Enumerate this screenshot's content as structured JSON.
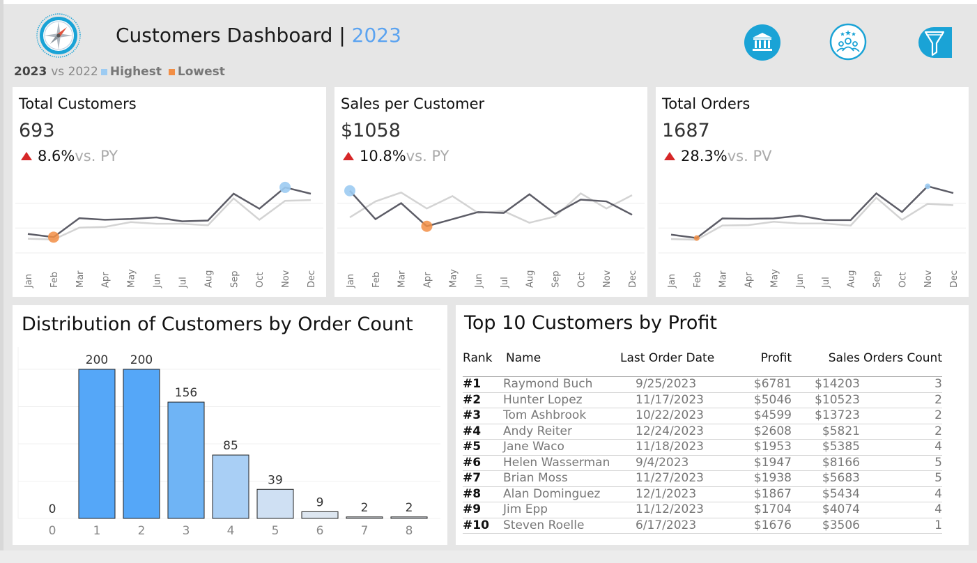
{
  "header": {
    "title_main": "Customers Dashboard",
    "title_sep": "|",
    "title_year": "2023",
    "legend": {
      "current": "2023",
      "vs": "vs 2022",
      "highest": "Highest",
      "lowest": "Lowest"
    },
    "icons": [
      "compass-logo-icon",
      "bank-icon",
      "customers-icon",
      "filter-icon"
    ],
    "colors": {
      "accent": "#5ba3f0",
      "highest": "#9ccbf2",
      "lowest": "#f28e45",
      "nav_icon": "#1aa3d6"
    }
  },
  "months": [
    "Jan",
    "Feb",
    "Mar",
    "Apr",
    "May",
    "Jun",
    "Jul",
    "Aug",
    "Sep",
    "Oct",
    "Nov",
    "Dec"
  ],
  "kpis": [
    {
      "title": "Total Customers",
      "value": "693",
      "change": "8.6%",
      "vs_label": "vs. PY",
      "chart_data": {
        "type": "line",
        "ylim": [
          20,
          110
        ],
        "grid": true,
        "series": [
          {
            "values": [
              44,
              40,
              64,
              62,
              63,
              65,
              60,
              61,
              95,
              76,
              103,
              95
            ],
            "highlight": {
              "highest": 10,
              "lowest": 1
            }
          },
          {
            "values": [
              38,
              37,
              52,
              53,
              59,
              57,
              57,
              55,
              89,
              62,
              86,
              87
            ]
          }
        ]
      }
    },
    {
      "title": "Sales per Customer",
      "value": "$1058",
      "change": "10.8%",
      "vs_label": "vs. PY",
      "chart_data": {
        "type": "line",
        "ylim": [
          700,
          1500
        ],
        "grid": true,
        "series": [
          {
            "values": [
              1400,
              1080,
              1260,
              1000,
              1080,
              1160,
              1150,
              1360,
              1140,
              1300,
              1280,
              1130
            ],
            "highlight": {
              "highest": 0,
              "lowest": 3
            }
          },
          {
            "values": [
              1100,
              1280,
              1380,
              1200,
              1340,
              1150,
              1170,
              1040,
              1110,
              1370,
              1200,
              1350
            ]
          }
        ]
      }
    },
    {
      "title": "Total Orders",
      "value": "1687",
      "change": "28.3%",
      "vs_label": "vs. PV",
      "chart_data": {
        "type": "line",
        "ylim": [
          50,
          260
        ],
        "grid": true,
        "series": [
          {
            "values": [
              104,
              94,
              152,
              151,
              152,
              160,
              147,
              147,
              226,
              171,
              247,
              227
            ],
            "highlight": {
              "highest": 10,
              "lowest": 1
            }
          },
          {
            "values": [
              91,
              89,
              131,
              132,
              142,
              137,
              137,
              131,
              213,
              148,
              195,
              191
            ]
          }
        ]
      }
    }
  ],
  "distribution": {
    "title": "Distribution of Customers by Order Count",
    "chart_data": {
      "type": "bar",
      "categories": [
        "0",
        "1",
        "2",
        "3",
        "4",
        "5",
        "6",
        "7",
        "8"
      ],
      "values": [
        0,
        200,
        200,
        156,
        85,
        39,
        9,
        2,
        2
      ],
      "ylim": [
        0,
        200
      ],
      "grid": true,
      "colors": [
        "#55a7f8",
        "#55a7f8",
        "#55a7f8",
        "#6fb4f5",
        "#a9cff5",
        "#cfe0f3",
        "#dde6f0",
        "#e3e8ef",
        "#e3e8ef"
      ]
    }
  },
  "top_customers": {
    "title": "Top 10 Customers by Profit",
    "columns": [
      "Rank",
      "Name",
      "Last Order Date",
      "Profit",
      "Sales",
      "Orders Count"
    ],
    "rows": [
      [
        "#1",
        "Raymond Buch",
        "9/25/2023",
        "$6781",
        "$14203",
        "3"
      ],
      [
        "#2",
        "Hunter Lopez",
        "11/17/2023",
        "$5046",
        "$10523",
        "2"
      ],
      [
        "#3",
        "Tom Ashbrook",
        "10/22/2023",
        "$4599",
        "$13723",
        "2"
      ],
      [
        "#4",
        "Andy Reiter",
        "12/24/2023",
        "$2608",
        "$5821",
        "2"
      ],
      [
        "#5",
        "Jane Waco",
        "11/18/2023",
        "$1953",
        "$5385",
        "4"
      ],
      [
        "#6",
        "Helen Wasserman",
        "9/4/2023",
        "$1947",
        "$8166",
        "5"
      ],
      [
        "#7",
        "Brian Moss",
        "11/27/2023",
        "$1938",
        "$5683",
        "5"
      ],
      [
        "#8",
        "Alan Dominguez",
        "12/1/2023",
        "$1867",
        "$5434",
        "4"
      ],
      [
        "#9",
        "Jim Epp",
        "11/12/2023",
        "$1704",
        "$4074",
        "4"
      ],
      [
        "#10",
        "Steven Roelle",
        "6/17/2023",
        "$1676",
        "$3506",
        "1"
      ]
    ]
  }
}
